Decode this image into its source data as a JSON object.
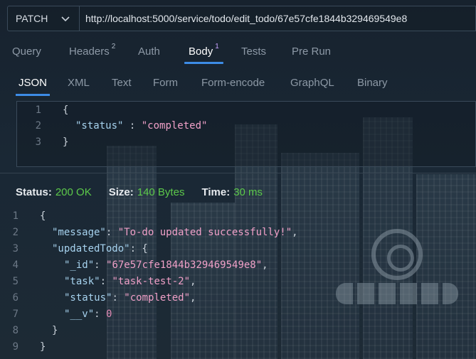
{
  "request": {
    "method": "PATCH",
    "url": "http://localhost:5000/service/todo/edit_todo/67e57cfe1844b329469549e8"
  },
  "request_tabs": [
    {
      "label": "Query",
      "badge": ""
    },
    {
      "label": "Headers",
      "badge": "2"
    },
    {
      "label": "Auth",
      "badge": ""
    },
    {
      "label": "Body",
      "badge": "1",
      "active": true
    },
    {
      "label": "Tests",
      "badge": ""
    },
    {
      "label": "Pre Run",
      "badge": ""
    }
  ],
  "body_tabs": [
    {
      "label": "JSON",
      "active": true
    },
    {
      "label": "XML"
    },
    {
      "label": "Text"
    },
    {
      "label": "Form"
    },
    {
      "label": "Form-encode"
    },
    {
      "label": "GraphQL"
    },
    {
      "label": "Binary"
    }
  ],
  "request_body": {
    "line_numbers": [
      "1",
      "2",
      "3"
    ],
    "open_brace": "{",
    "key": "\"status\"",
    "sep": " : ",
    "value": "\"completed\"",
    "close_brace": "}"
  },
  "status": {
    "status_label": "Status:",
    "status_value": "200 OK",
    "size_label": "Size:",
    "size_value": "140 Bytes",
    "time_label": "Time:",
    "time_value": "30 ms"
  },
  "response_body": {
    "line_numbers": [
      "1",
      "2",
      "3",
      "4",
      "5",
      "6",
      "7",
      "8",
      "9"
    ],
    "l1": "{",
    "l2_key": "\"message\"",
    "l2_val": "\"To-do updated successfully!\"",
    "l3_key": "\"updatedTodo\"",
    "l3_rest": ": {",
    "l4_key": "\"_id\"",
    "l4_val": "\"67e57cfe1844b329469549e8\"",
    "l5_key": "\"task\"",
    "l5_val": "\"task-test-2\"",
    "l6_key": "\"status\"",
    "l6_val": "\"completed\"",
    "l7_key": "\"__v\"",
    "l7_val": "0",
    "l8": "}",
    "l9": "}"
  },
  "colors": {
    "accent": "#3d8ce6",
    "status_ok": "#5cc94a",
    "json_key": "#a7d3ef",
    "json_string": "#f0a0c8"
  },
  "icons": {
    "method_dropdown": "chevron-down-icon"
  }
}
